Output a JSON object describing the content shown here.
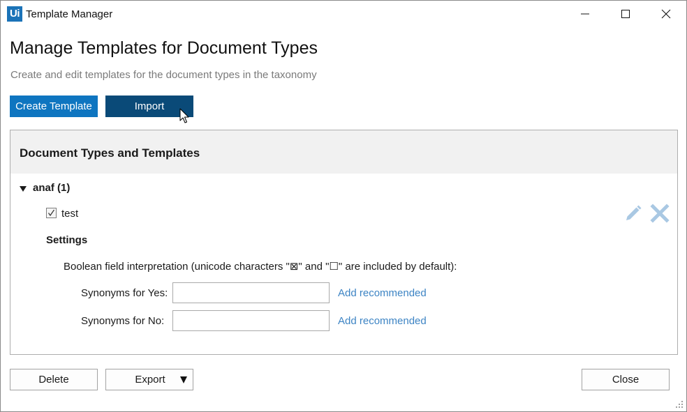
{
  "window": {
    "app_logo_text": "Ui",
    "title": "Template Manager"
  },
  "page": {
    "heading": "Manage Templates for Document Types",
    "subheading": "Create and edit templates for the document types in the taxonomy"
  },
  "toolbar": {
    "create_label": "Create Template",
    "import_label": "Import"
  },
  "panel": {
    "title": "Document Types and Templates",
    "doc_type": {
      "label": "anaf (1)",
      "expanded": true,
      "template": {
        "name": "test",
        "checked": true
      },
      "settings": {
        "label": "Settings",
        "boolean_interpretation": "Boolean field interpretation (unicode characters \"⊠\" and \"☐\" are included by default):",
        "yes": {
          "label": "Synonyms for Yes:",
          "value": "",
          "link": "Add recommended"
        },
        "no": {
          "label": "Synonyms for No:",
          "value": "",
          "link": "Add recommended"
        }
      }
    }
  },
  "footer": {
    "delete_label": "Delete",
    "export_label": "Export",
    "close_label": "Close"
  },
  "icons": {
    "edit": "pencil-icon",
    "remove": "x-icon"
  },
  "colors": {
    "primary": "#0e75c0",
    "primary_pressed": "#0a4a78",
    "link": "#3d84c4",
    "icon_muted": "#a9c8e3",
    "panel_header": "#f1f1f1"
  }
}
